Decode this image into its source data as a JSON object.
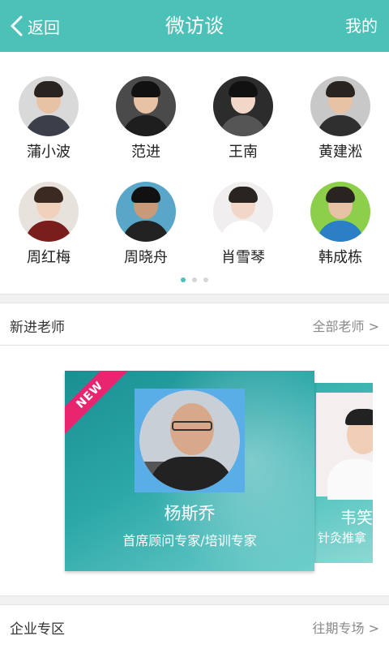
{
  "header": {
    "back_label": "返回",
    "title": "微访谈",
    "mine_label": "我的"
  },
  "teachers": [
    {
      "name": "蒲小波"
    },
    {
      "name": "范进"
    },
    {
      "name": "王南"
    },
    {
      "name": "黄建淞"
    },
    {
      "name": "周红梅"
    },
    {
      "name": "周晓舟"
    },
    {
      "name": "肖雪琴"
    },
    {
      "name": "韩成栋"
    }
  ],
  "pager": {
    "count": 3,
    "active": 1
  },
  "new_teachers": {
    "title": "新进老师",
    "link": "全部老师 >",
    "cards": [
      {
        "badge": "NEW",
        "name": "杨斯乔",
        "role": "首席顾问专家/培训专家"
      },
      {
        "name": "韦笑",
        "role": "针灸推拿"
      }
    ]
  },
  "enterprise": {
    "title": "企业专区",
    "link": "往期专场 >"
  },
  "colors": {
    "accent": "#4cc1b8",
    "badge": "#e8256e"
  }
}
